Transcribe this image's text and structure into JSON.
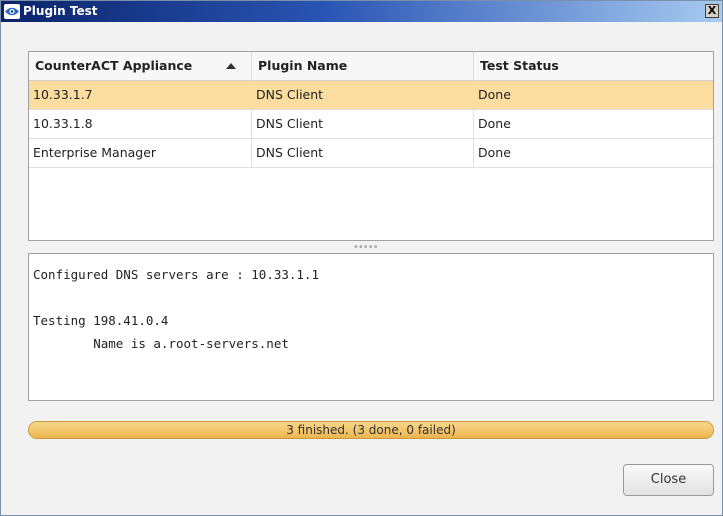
{
  "window": {
    "title": "Plugin Test",
    "close_label": "X"
  },
  "table": {
    "columns": [
      "CounterACT Appliance",
      "Plugin Name",
      "Test Status"
    ],
    "sorted_column": "CounterACT Appliance",
    "sort_direction": "ascending",
    "rows": [
      {
        "appliance": "10.33.1.7",
        "plugin": "DNS Client",
        "status": "Done",
        "selected": true
      },
      {
        "appliance": "10.33.1.8",
        "plugin": "DNS Client",
        "status": "Done",
        "selected": false
      },
      {
        "appliance": "Enterprise Manager",
        "plugin": "DNS Client",
        "status": "Done",
        "selected": false
      }
    ]
  },
  "output": {
    "lines": [
      "Configured DNS servers are : 10.33.1.1",
      "",
      "Testing 198.41.0.4",
      "        Name is a.root-servers.net"
    ]
  },
  "progress": {
    "text": "3 finished. (3 done, 0 failed)",
    "fraction": 1.0
  },
  "footer": {
    "close_label": "Close"
  },
  "colors": {
    "selected_row": "#fadd9f",
    "progress_bar": "#f3c86a",
    "title_bar": "#0a246a"
  }
}
